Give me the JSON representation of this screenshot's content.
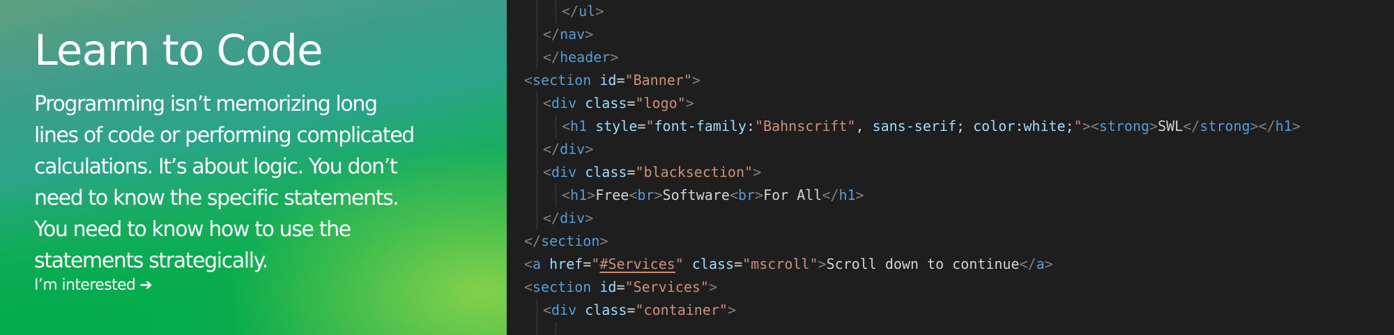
{
  "hero": {
    "title": "Learn to Code",
    "body_lines": [
      "Programming isn’t memorizing long",
      "lines of code or performing complicated",
      "calculations. It’s about logic. You don’t",
      "need to know the specific statements.",
      "You need to know how to use the",
      "statements strategically."
    ],
    "cta_label": "I’m interested",
    "cta_arrow": "➔"
  },
  "code_lines": [
    {
      "indent": 3,
      "tokens": [
        {
          "k": "p",
          "v": "</"
        },
        {
          "k": "t",
          "v": "ul"
        },
        {
          "k": "p",
          "v": ">"
        }
      ]
    },
    {
      "indent": 2,
      "tokens": [
        {
          "k": "p",
          "v": "</"
        },
        {
          "k": "t",
          "v": "nav"
        },
        {
          "k": "p",
          "v": ">"
        }
      ]
    },
    {
      "indent": 2,
      "tokens": [
        {
          "k": "p",
          "v": "</"
        },
        {
          "k": "t",
          "v": "header"
        },
        {
          "k": "p",
          "v": ">"
        }
      ]
    },
    {
      "indent": 1,
      "tokens": [
        {
          "k": "p",
          "v": "<"
        },
        {
          "k": "t",
          "v": "section"
        },
        {
          "k": "x",
          "v": " "
        },
        {
          "k": "a",
          "v": "id"
        },
        {
          "k": "x",
          "v": "="
        },
        {
          "k": "s",
          "v": "\"Banner\""
        },
        {
          "k": "p",
          "v": ">"
        }
      ]
    },
    {
      "indent": 2,
      "tokens": [
        {
          "k": "p",
          "v": "<"
        },
        {
          "k": "t",
          "v": "div"
        },
        {
          "k": "x",
          "v": " "
        },
        {
          "k": "a",
          "v": "class"
        },
        {
          "k": "x",
          "v": "="
        },
        {
          "k": "s",
          "v": "\"logo\""
        },
        {
          "k": "p",
          "v": ">"
        }
      ]
    },
    {
      "indent": 3,
      "tokens": [
        {
          "k": "p",
          "v": "<"
        },
        {
          "k": "t",
          "v": "h1"
        },
        {
          "k": "x",
          "v": " "
        },
        {
          "k": "a",
          "v": "style"
        },
        {
          "k": "x",
          "v": "="
        },
        {
          "k": "s",
          "v": "\""
        },
        {
          "k": "a",
          "v": "font-family"
        },
        {
          "k": "x",
          "v": ":"
        },
        {
          "k": "s",
          "v": "\"Bahnscrift\""
        },
        {
          "k": "x",
          "v": ", "
        },
        {
          "k": "a",
          "v": "sans-serif"
        },
        {
          "k": "x",
          "v": "; "
        },
        {
          "k": "a",
          "v": "color"
        },
        {
          "k": "x",
          "v": ":"
        },
        {
          "k": "a",
          "v": "white"
        },
        {
          "k": "x",
          "v": ";"
        },
        {
          "k": "s",
          "v": "\""
        },
        {
          "k": "p",
          "v": "><"
        },
        {
          "k": "t",
          "v": "strong"
        },
        {
          "k": "p",
          "v": ">"
        },
        {
          "k": "x",
          "v": "SWL"
        },
        {
          "k": "p",
          "v": "</"
        },
        {
          "k": "t",
          "v": "strong"
        },
        {
          "k": "p",
          "v": "></"
        },
        {
          "k": "t",
          "v": "h1"
        },
        {
          "k": "p",
          "v": ">"
        }
      ]
    },
    {
      "indent": 2,
      "tokens": [
        {
          "k": "p",
          "v": "</"
        },
        {
          "k": "t",
          "v": "div"
        },
        {
          "k": "p",
          "v": ">"
        }
      ]
    },
    {
      "indent": 2,
      "tokens": [
        {
          "k": "p",
          "v": "<"
        },
        {
          "k": "t",
          "v": "div"
        },
        {
          "k": "x",
          "v": " "
        },
        {
          "k": "a",
          "v": "class"
        },
        {
          "k": "x",
          "v": "="
        },
        {
          "k": "s",
          "v": "\"blacksection\""
        },
        {
          "k": "p",
          "v": ">"
        }
      ]
    },
    {
      "indent": 3,
      "tokens": [
        {
          "k": "p",
          "v": "<"
        },
        {
          "k": "t",
          "v": "h1"
        },
        {
          "k": "p",
          "v": ">"
        },
        {
          "k": "x",
          "v": "Free"
        },
        {
          "k": "p",
          "v": "<"
        },
        {
          "k": "t",
          "v": "br"
        },
        {
          "k": "p",
          "v": ">"
        },
        {
          "k": "x",
          "v": "Software"
        },
        {
          "k": "p",
          "v": "<"
        },
        {
          "k": "t",
          "v": "br"
        },
        {
          "k": "p",
          "v": ">"
        },
        {
          "k": "x",
          "v": "For All"
        },
        {
          "k": "p",
          "v": "</"
        },
        {
          "k": "t",
          "v": "h1"
        },
        {
          "k": "p",
          "v": ">"
        }
      ]
    },
    {
      "indent": 2,
      "tokens": [
        {
          "k": "p",
          "v": "</"
        },
        {
          "k": "t",
          "v": "div"
        },
        {
          "k": "p",
          "v": ">"
        }
      ]
    },
    {
      "indent": 1,
      "tokens": [
        {
          "k": "p",
          "v": "</"
        },
        {
          "k": "t",
          "v": "section"
        },
        {
          "k": "p",
          "v": ">"
        }
      ]
    },
    {
      "indent": 1,
      "tokens": [
        {
          "k": "p",
          "v": "<"
        },
        {
          "k": "t",
          "v": "a"
        },
        {
          "k": "x",
          "v": " "
        },
        {
          "k": "a",
          "v": "href"
        },
        {
          "k": "x",
          "v": "="
        },
        {
          "k": "s",
          "v": "\""
        },
        {
          "k": "link",
          "v": "#Services"
        },
        {
          "k": "s",
          "v": "\""
        },
        {
          "k": "x",
          "v": " "
        },
        {
          "k": "a",
          "v": "class"
        },
        {
          "k": "x",
          "v": "="
        },
        {
          "k": "s",
          "v": "\"mscroll\""
        },
        {
          "k": "p",
          "v": ">"
        },
        {
          "k": "x",
          "v": "Scroll down to continue"
        },
        {
          "k": "p",
          "v": "</"
        },
        {
          "k": "t",
          "v": "a"
        },
        {
          "k": "p",
          "v": ">"
        }
      ]
    },
    {
      "indent": 1,
      "tokens": [
        {
          "k": "p",
          "v": "<"
        },
        {
          "k": "t",
          "v": "section"
        },
        {
          "k": "x",
          "v": " "
        },
        {
          "k": "a",
          "v": "id"
        },
        {
          "k": "x",
          "v": "="
        },
        {
          "k": "s",
          "v": "\"Services\""
        },
        {
          "k": "p",
          "v": ">"
        }
      ]
    },
    {
      "indent": 2,
      "tokens": [
        {
          "k": "p",
          "v": "<"
        },
        {
          "k": "t",
          "v": "div"
        },
        {
          "k": "x",
          "v": " "
        },
        {
          "k": "a",
          "v": "class"
        },
        {
          "k": "x",
          "v": "="
        },
        {
          "k": "s",
          "v": "\"container\""
        },
        {
          "k": "p",
          "v": ">"
        }
      ]
    },
    {
      "indent": 3,
      "tokens": []
    }
  ],
  "colors": {
    "editor_bg": "#1e1e1e",
    "punctuation": "#808080",
    "tag": "#569cd6",
    "attribute": "#9cdcfe",
    "string": "#ce9178",
    "text": "#d4d4d4",
    "indent_guide": "#404040"
  }
}
